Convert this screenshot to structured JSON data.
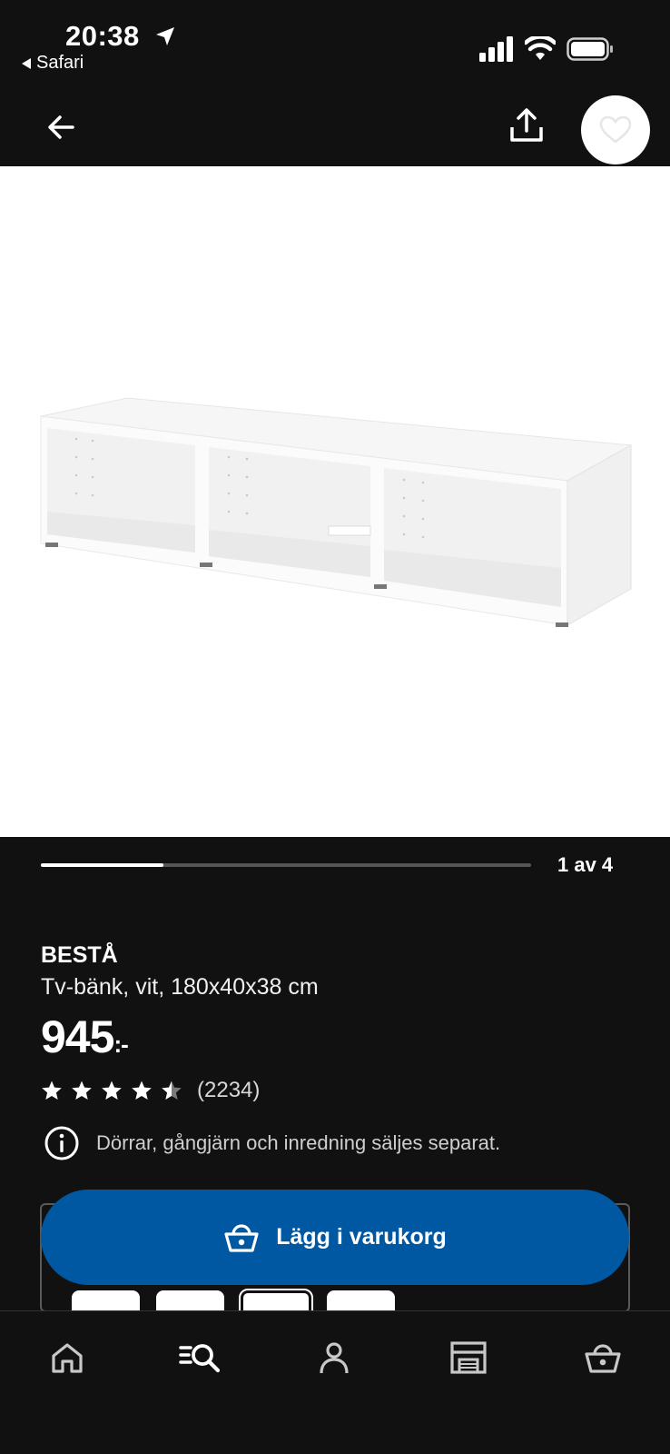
{
  "status_bar": {
    "time": "20:38",
    "back_app": "Safari"
  },
  "product": {
    "name": "BESTÅ",
    "description": "Tv-bänk, vit, 180x40x38 cm",
    "price": "945",
    "price_suffix": ":-",
    "rating": 4.5,
    "reviews": "(2234)",
    "info": "Dörrar, gångjärn och inredning säljes separat."
  },
  "carousel": {
    "counter": "1 av 4",
    "current": 1,
    "total": 4
  },
  "cart_button": {
    "label": "Lägg i varukorg"
  },
  "bottom_nav": {
    "tabs": [
      "home-icon",
      "search-icon",
      "profile-icon",
      "store-icon",
      "cart-icon"
    ]
  },
  "colors": {
    "background": "#111111",
    "accent": "#0058a3",
    "text": "#ffffff"
  }
}
